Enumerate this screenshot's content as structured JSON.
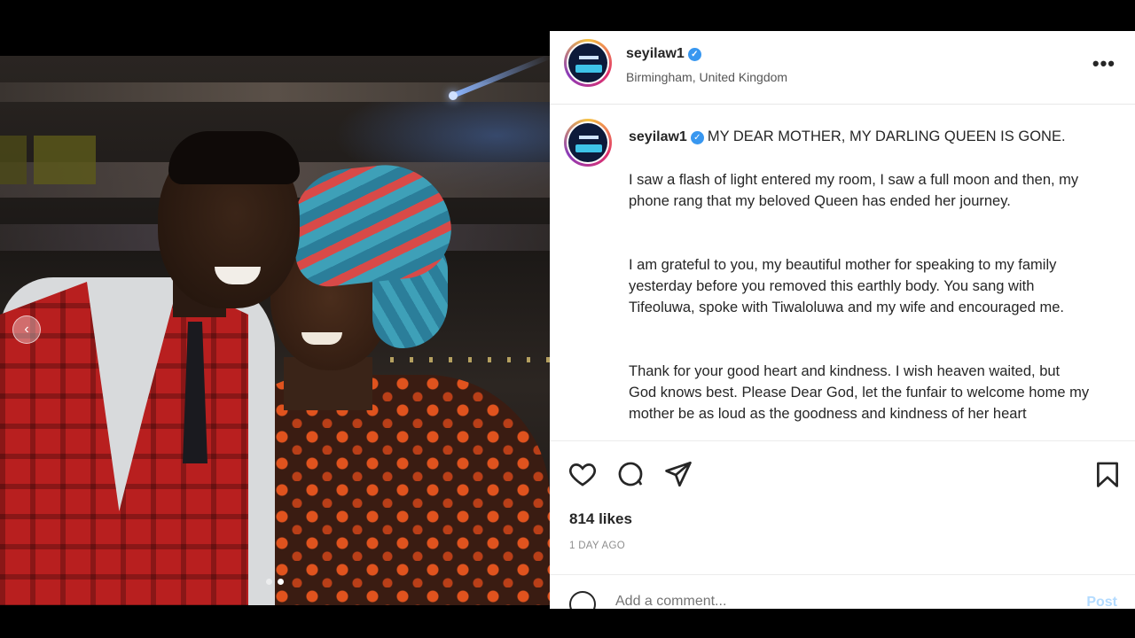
{
  "post": {
    "username": "seyilaw1",
    "location": "Birmingham, United Kingdom",
    "caption_title": "MY DEAR MOTHER, MY DARLING QUEEN IS GONE.",
    "paragraphs": [
      "I saw a flash of light entered my room, I saw a full moon and then, my phone rang that my beloved Queen has ended her journey.",
      "I am grateful to you, my beautiful mother for speaking to my family yesterday before you removed this earthly body. You sang with Tifeoluwa, spoke with Tiwaloluwa and my wife and encouraged me.",
      "Thank for your good heart and kindness. I wish heaven waited, but God knows best. Please Dear God, let the funfair to welcome home my mother be as loud as the goodness and kindness of her heart"
    ],
    "likes": "814 likes",
    "time": "1 DAY AGO",
    "comment_placeholder": "Add a comment...",
    "post_label": "Post",
    "verified_glyph": "✓",
    "more_glyph": "•••"
  },
  "carousel": {
    "prev_glyph": "‹",
    "slides_total": 2,
    "current_slide": 2
  },
  "colors": {
    "verified": "#3897f0",
    "text": "#262626",
    "muted": "#8e8e8e",
    "post_button": "#b3dbff"
  },
  "icons": [
    "heart-icon",
    "comment-icon",
    "share-icon",
    "bookmark-icon",
    "emoji-icon",
    "more-icon",
    "verified-icon",
    "carousel-prev-icon"
  ]
}
